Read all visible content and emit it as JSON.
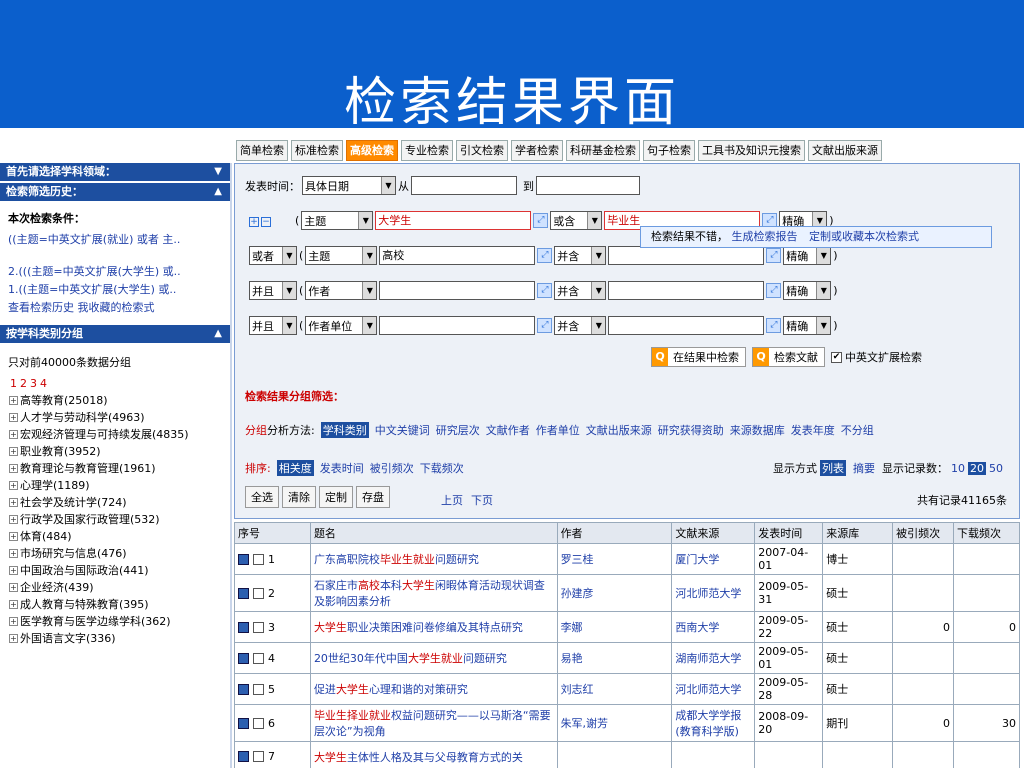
{
  "banner": {
    "title": "检索结果界面"
  },
  "tabs": [
    "简单检索",
    "标准检索",
    "高级检索",
    "专业检索",
    "引文检索",
    "学者检索",
    "科研基金检索",
    "句子检索",
    "工具书及知识元搜索",
    "文献出版来源"
  ],
  "active_tab": "高级检索",
  "sidebar": {
    "field_header": "首先请选择学科领域：",
    "history_header": "检索筛选历史：",
    "current_label": "本次检索条件：",
    "current_value": "((主题=中英文扩展(就业) 或者 主..",
    "history": [
      "2.(((主题=中英文扩展(大学生) 或..",
      "1.((主题=中英文扩展(大学生) 或.."
    ],
    "history_links": "查看检索历史  我收藏的检索式",
    "group_header": "按学科类别分组",
    "group_note": "只对前40000条数据分组",
    "pages": [
      "1",
      "2",
      "3",
      "4"
    ],
    "categories": [
      "高等教育(25018)",
      "人才学与劳动科学(4963)",
      "宏观经济管理与可持续发展(4835)",
      "职业教育(3952)",
      "教育理论与教育管理(1961)",
      "心理学(1189)",
      "社会学及统计学(724)",
      "行政学及国家行政管理(532)",
      "体育(484)",
      "市场研究与信息(476)",
      "中国政治与国际政治(441)",
      "企业经济(439)",
      "成人教育与特殊教育(395)",
      "医学教育与医学边缘学科(362)",
      "外国语言文字(336)"
    ]
  },
  "form": {
    "date_label": "发表时间：",
    "date_select": "具体日期",
    "from_label": "从",
    "to_label": "到",
    "rows": [
      {
        "logic": "",
        "field": "主题",
        "term1": "大学生",
        "combine": "或含",
        "term2": "毕业生",
        "match": "精确"
      },
      {
        "logic": "或者",
        "field": "主题",
        "term1": "高校",
        "combine": "并含",
        "term2": "",
        "match": "精确"
      },
      {
        "logic": "并且",
        "field": "作者",
        "term1": "",
        "combine": "并含",
        "term2": "",
        "match": "精确"
      },
      {
        "logic": "并且",
        "field": "作者单位",
        "term1": "",
        "combine": "并含",
        "term2": "",
        "match": "精确"
      }
    ],
    "search_in_results": "在结果中检索",
    "search_btn": "检索文献",
    "ext_label": "中英文扩展检索"
  },
  "filter": {
    "title": "检索结果分组筛选：",
    "tip": "检索结果不错，",
    "report_link": "生成检索报告",
    "save_link": "定制或收藏本次检索式",
    "group_label_red": "分组",
    "group_label": "分析方法:",
    "group_active": "学科类别",
    "group_options": [
      "中文关键词",
      "研究层次",
      "文献作者",
      "作者单位",
      "文献出版来源",
      "研究获得资助",
      "来源数据库",
      "发表年度",
      "不分组"
    ]
  },
  "sort": {
    "label": "排序:",
    "active": "相关度",
    "options": [
      "发表时间",
      "被引频次",
      "下载频次"
    ],
    "display_label": "显示方式",
    "display_active": "列表",
    "display_other": "摘要",
    "count_label": "显示记录数：",
    "count_options": [
      "10",
      "20",
      "50"
    ],
    "count_active": "20"
  },
  "actions": [
    "全选",
    "清除",
    "定制",
    "存盘"
  ],
  "pager": {
    "prev": "上页",
    "next": "下页"
  },
  "total": "共有记录41165条",
  "table": {
    "headers": [
      "序号",
      "题名",
      "作者",
      "文献来源",
      "发表时间",
      "来源库",
      "被引频次",
      "下载频次"
    ],
    "rows": [
      {
        "no": "1",
        "title": [
          [
            "广东高职院校",
            false
          ],
          [
            "毕业生就业",
            true
          ],
          [
            "问题研究",
            false
          ]
        ],
        "author": "罗三桂",
        "source": "厦门大学",
        "date": "2007-04-01",
        "db": "博士",
        "cite": "",
        "dl": ""
      },
      {
        "no": "2",
        "title": [
          [
            "石家庄市",
            false
          ],
          [
            "高校",
            true
          ],
          [
            "本科",
            false
          ],
          [
            "大学生",
            true
          ],
          [
            "闲暇体育活动现状调查及影响因素分析",
            false
          ]
        ],
        "author": "孙建彦",
        "source": "河北师范大学",
        "date": "2009-05-31",
        "db": "硕士",
        "cite": "",
        "dl": ""
      },
      {
        "no": "3",
        "title": [
          [
            "大学生",
            true
          ],
          [
            "职业决策困难问卷修编及其特点研究",
            false
          ]
        ],
        "author": "李娜",
        "source": "西南大学",
        "date": "2009-05-22",
        "db": "硕士",
        "cite": "0",
        "dl": "0"
      },
      {
        "no": "4",
        "title": [
          [
            "20世纪30年代中国",
            false
          ],
          [
            "大学生就业",
            true
          ],
          [
            "问题研究",
            false
          ]
        ],
        "author": "易艳",
        "source": "湖南师范大学",
        "date": "2009-05-01",
        "db": "硕士",
        "cite": "",
        "dl": ""
      },
      {
        "no": "5",
        "title": [
          [
            "促进",
            false
          ],
          [
            "大学生",
            true
          ],
          [
            "心理和谐的对策研究",
            false
          ]
        ],
        "author": "刘志红",
        "source": "河北师范大学",
        "date": "2009-05-28",
        "db": "硕士",
        "cite": "",
        "dl": ""
      },
      {
        "no": "6",
        "title": [
          [
            "毕业生择业就业",
            true
          ],
          [
            "权益问题研究——以马斯洛“需要层次论”为视角",
            false
          ]
        ],
        "author": "朱军,谢芳",
        "source": "成都大学学报(教育科学版)",
        "date": "2008-09-20",
        "db": "期刊",
        "cite": "0",
        "dl": "30"
      },
      {
        "no": "7",
        "title": [
          [
            "大学生",
            true
          ],
          [
            "主体性人格及其与父母教育方式的关",
            false
          ]
        ],
        "author": "",
        "source": "",
        "date": "",
        "db": "",
        "cite": "",
        "dl": ""
      }
    ]
  }
}
